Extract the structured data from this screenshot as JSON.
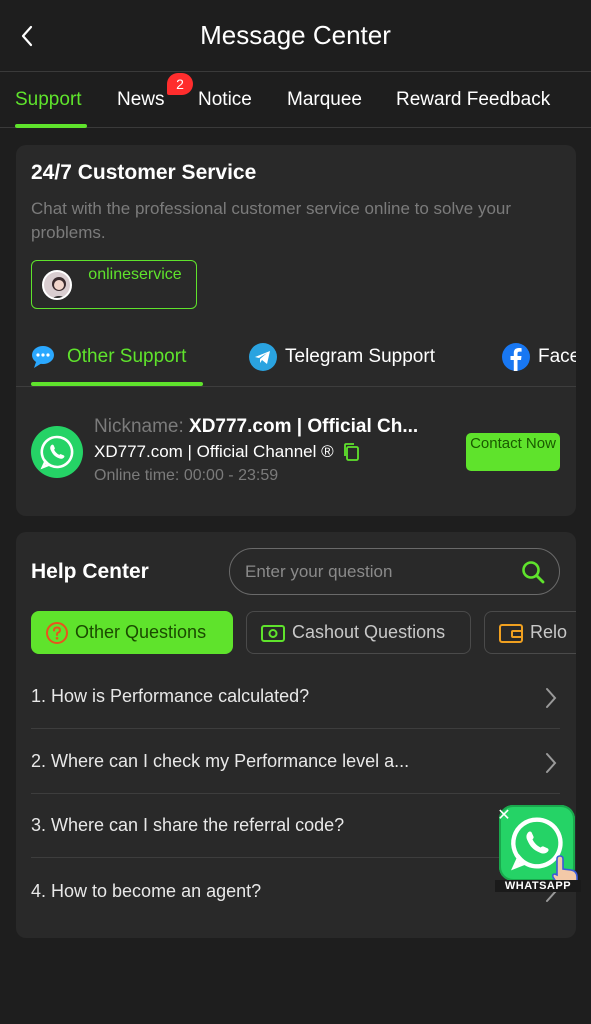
{
  "header": {
    "title": "Message Center"
  },
  "tabs": [
    {
      "label": "Support"
    },
    {
      "label": "News",
      "badge": "2"
    },
    {
      "label": "Notice"
    },
    {
      "label": "Marquee"
    },
    {
      "label": "Reward Feedback"
    }
  ],
  "customer_service": {
    "title": "24/7 Customer Service",
    "description": "Chat with the professional customer service online to solve your problems.",
    "online_service_label": "onlineservice",
    "sub_tabs": [
      {
        "label": "Other Support"
      },
      {
        "label": "Telegram Support"
      },
      {
        "label": "Face"
      }
    ],
    "contact": {
      "nickname_prefix": "Nickname:",
      "nickname": "XD777.com | Official Ch...",
      "channel": "XD777.com | Official Channel ®",
      "online_time": "Online time: 00:00 - 23:59",
      "button": "Contact Now"
    }
  },
  "help_center": {
    "title": "Help Center",
    "search_placeholder": "Enter your question",
    "categories": [
      {
        "label": "Other Questions"
      },
      {
        "label": "Cashout Questions"
      },
      {
        "label": "Relo"
      }
    ],
    "questions": [
      "1. How is Performance calculated?",
      "2. Where can I check my Performance level a...",
      "3. Where can I share the referral code?",
      "4. How to become an agent?"
    ]
  },
  "floating_whatsapp": {
    "label": "WHATSAPP"
  },
  "colors": {
    "accent": "#5fe32c",
    "badge": "#ff2d2d",
    "whatsapp": "#25d366",
    "background": "#1e1e1e",
    "card": "#292929"
  }
}
